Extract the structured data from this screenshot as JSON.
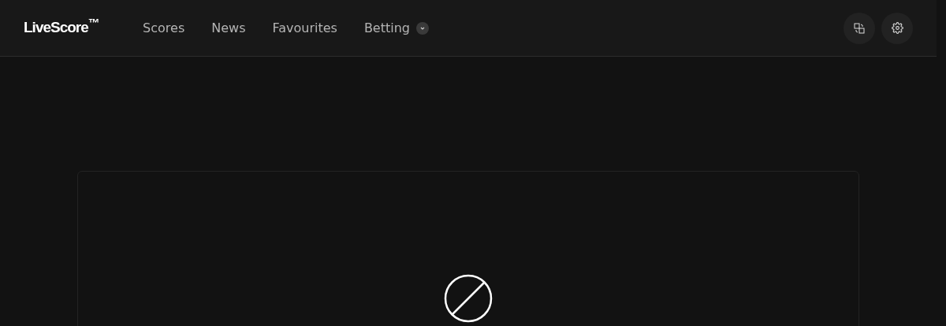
{
  "header": {
    "logo": "LiveScore$^{™}$",
    "nav": [
      {
        "label": "Scores",
        "kind": "link"
      },
      {
        "label": "News",
        "kind": "link"
      },
      {
        "label": "Favourites",
        "kind": "link"
      },
      {
        "label": "Betting",
        "kind": "dropdown"
      }
    ],
    "actions": [
      {
        "kind": "language"
      },
      {
        "kind": "settings"
      }
    ]
  },
  "content": {
    "kind": "blocked"
  }
}
